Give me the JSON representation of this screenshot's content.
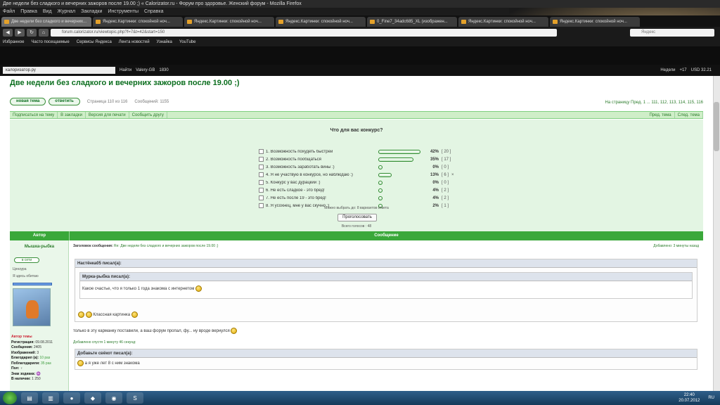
{
  "window": {
    "title": "Две недели без сладкого и вечерних зажоров после 19.00 ;) « Calorizator.ru - Форум про здоровье. Женский форум - Mozilla Firefox"
  },
  "menubar": [
    "Файл",
    "Правка",
    "Вид",
    "Журнал",
    "Закладки",
    "Инструменты",
    "Справка"
  ],
  "tabs": [
    {
      "label": "Две недели без сладкого и вечерних..."
    },
    {
      "label": "Яндекс.Картинки: спокойной ноч..."
    },
    {
      "label": "Яндекс.Картинки: спокойной ноч..."
    },
    {
      "label": "Яндекс.Картинки: спокойной ноч..."
    },
    {
      "label": "0_Fine7_34adc685_XL (изображен..."
    },
    {
      "label": "Яндекс.Картинки: спокойной ноч..."
    },
    {
      "label": "Яндекс.Картинки: спокойной ноч..."
    },
    {
      "label": "Яндекс.Картинки: спокойной..."
    }
  ],
  "nav": {
    "url": "forum.calorizator.ru/viewtopic.php?f=7&t=42&start=150",
    "search_placeholder": "Яндекс"
  },
  "bookmarks": [
    "Избранное",
    "Часто посещаемые",
    "Сервисы Яндекса",
    "Лента новостей",
    "Узнайка",
    "YouTube"
  ],
  "toolbar2": {
    "site": "калоризатор.ру",
    "search_btn": "Найти",
    "user": "Valery-GB",
    "count": "1830",
    "temp": "+17",
    "usd": "USD 32.21",
    "weather": "Недели"
  },
  "page": {
    "title": "Две недели без сладкого и вечерних зажоров после 19.00 ;)",
    "new_topic_btn": "новая тема",
    "reply_btn": "ответить",
    "pages_info": "Страница 110 из 116",
    "messages_info": "Сообщений: 1155",
    "pages_right": "На страницу Пред. 1 ... 111, 112, 113, 114, 115, 116",
    "greenbar": [
      "Подписаться на тему",
      "В закладки",
      "Версия для печати",
      "Сообщить другу"
    ],
    "greenbar_right": [
      "Пред. тема",
      "След. тема"
    ]
  },
  "poll": {
    "question": "Что для вас конкурс?",
    "options": [
      {
        "label": "1. Возможность похудеть быстрей",
        "pct": 42,
        "count": "[ 20 ]"
      },
      {
        "label": "2. Возможность пообщаться",
        "pct": 35,
        "count": "[ 17 ]"
      },
      {
        "label": "3. Возможность заработать вины :)",
        "pct": 0,
        "count": "[ 0 ]"
      },
      {
        "label": "4. Я не участвую в конкурсе, но наблюдаю :)",
        "pct": 13,
        "count": "[ 6 ]",
        "extra": "×"
      },
      {
        "label": "5. Конкурс у вас дурацкий :)",
        "pct": 0,
        "count": "[ 0 ]"
      },
      {
        "label": "6. Не есть сладкое - это бред!",
        "pct": 4,
        "count": "[ 2 ]"
      },
      {
        "label": "7. Не есть после 19 - это бред!",
        "pct": 4,
        "count": "[ 2 ]"
      },
      {
        "label": "8. Я усохнец, мне у вас скучно :)",
        "pct": 2,
        "count": "[ 1 ]"
      }
    ],
    "pct_labels": [
      "42%",
      "35%",
      "0%",
      "13%",
      "0%",
      "4%",
      "4%",
      "2%"
    ],
    "footer_max": "Можно выбрать до: 8 вариантов ответа",
    "vote_btn": "Проголосовать",
    "total": "Всего голосов : 48"
  },
  "table": {
    "author_col": "Автор",
    "message_col": "Сообщение"
  },
  "author": {
    "name": "Мышка-рыбка",
    "btn": "в сети",
    "status1": "Цензура",
    "status2": "Я здесь обитаю",
    "stats": [
      {
        "k": "Автор темы",
        "v": "",
        "cls": "red"
      },
      {
        "k": "Регистрация:",
        "v": "09.08.2011"
      },
      {
        "k": "Сообщения:",
        "v": "2405"
      },
      {
        "k": "Изображений:",
        "v": "3"
      },
      {
        "k": "Благодарил (а):",
        "v": "10 раз"
      },
      {
        "k": "Поблагодарили:",
        "v": "35 раз"
      },
      {
        "k": "Пол:",
        "v": "♀"
      },
      {
        "k": "Знак зодиака:",
        "v": "♒"
      },
      {
        "k": "В наличии:",
        "v": "1 250"
      }
    ]
  },
  "post": {
    "header_label": "Заголовок сообщения:",
    "header_text": "Re: Две недели без сладкого и вечерних зажоров после 19.00 ;)",
    "added": "Добавлено: 3 минуты назад",
    "quote_author": "Настёнка05 писал(а):",
    "inner_quote_author": "Мурка-рыбка писал(а):",
    "inner_quote_text": "Какое счастье, что я только 1 года знакома с интернетом",
    "quote_reply": "Классная картинка",
    "text1": "только в эту карманку поставили, а ваш форум пропал, фу... ну вроде вернулся",
    "text2": "Добавлено спустя 1 минуту 46 секунд:",
    "quote3_author": "Добавьте свёкот писал(а):",
    "quote3_text": "а я уже лет 8 с ним знакома"
  },
  "taskbar": {
    "time": "22:40",
    "date": "20.07.2012",
    "lang": "RU"
  }
}
